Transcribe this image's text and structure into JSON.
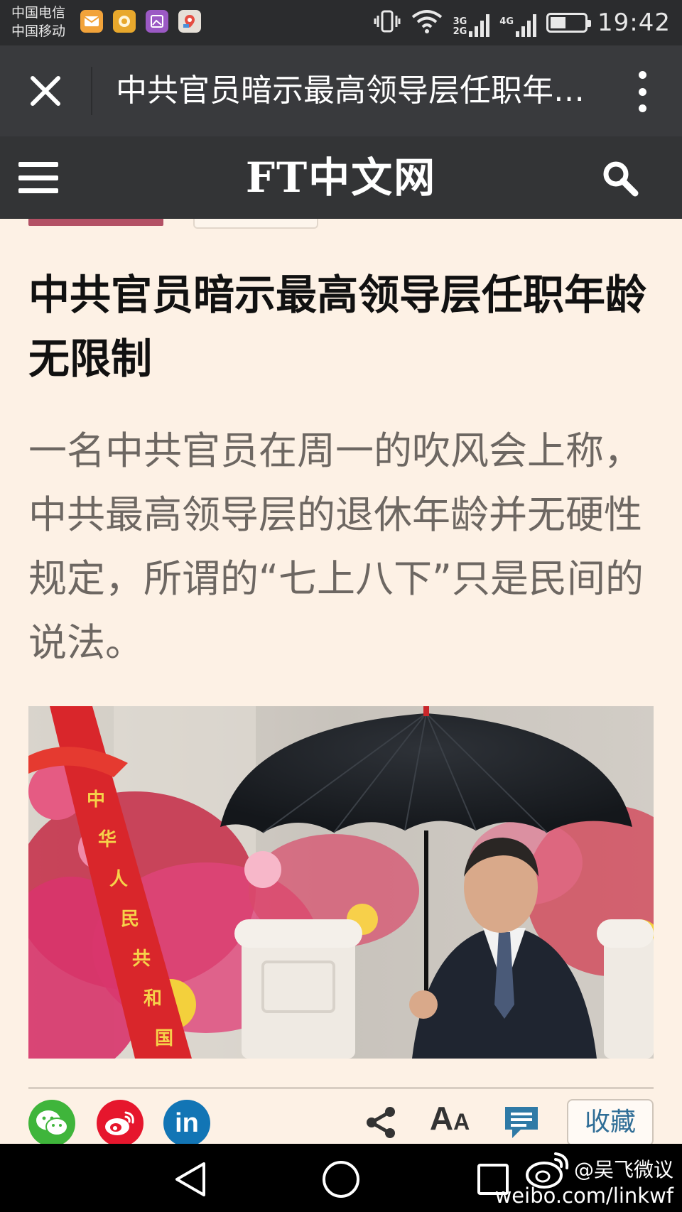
{
  "status_bar": {
    "carrier_1": "中国电信",
    "carrier_2": "中国移动",
    "net_3g": "3G",
    "net_2g": "2G",
    "net_4g": "4G",
    "battery_percent": 45,
    "time": "19:42",
    "notification_icons": [
      "mail-icon",
      "hand-icon",
      "photo-icon",
      "maps-icon"
    ]
  },
  "browser": {
    "title": "中共官员暗示最高领导层任职年龄无限制",
    "close_icon": "close-icon",
    "menu_icon": "more-vertical-icon"
  },
  "site_header": {
    "logo": "FT中文网",
    "menu_icon": "hamburger-icon",
    "search_icon": "search-icon"
  },
  "article": {
    "headline": "中共官员暗示最高领导层任职年龄无限制",
    "lead": "一名中共官员在周一的吹风会上称，中共最高领导层的退休年龄并无硬性规定，所谓的“七上八下”只是民间的说法。",
    "photo_ribbon_text": "中华人民共和国"
  },
  "share_bar": {
    "icons": [
      "wechat-icon",
      "weibo-icon",
      "linkedin-icon",
      "share-icon",
      "font-size-icon",
      "comment-icon"
    ],
    "linkedin_label": "in",
    "font_label": "AA",
    "favorite_label": "收藏"
  },
  "nav_bar": {
    "buttons": [
      "back-icon",
      "home-icon",
      "recents-icon"
    ]
  },
  "watermark": {
    "handle": "@吴飞微议",
    "url": "weibo.com/linkwf"
  },
  "colors": {
    "page_bg": "#fdf1e5",
    "header_bg": "#333436",
    "titlebar_bg": "#393a3d",
    "wechat": "#3fb53b",
    "weibo": "#e6162d",
    "linkedin": "#1275b5",
    "comment": "#2f7aa6"
  }
}
